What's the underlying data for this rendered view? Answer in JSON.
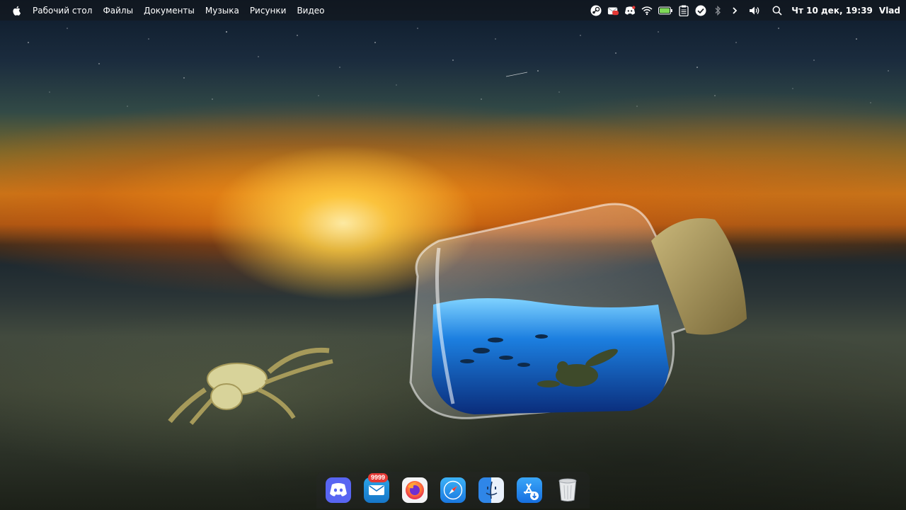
{
  "menubar": {
    "apple_icon": "apple-logo-icon",
    "items": [
      {
        "label": "Рабочий стол"
      },
      {
        "label": "Файлы"
      },
      {
        "label": "Документы"
      },
      {
        "label": "Музыка"
      },
      {
        "label": "Рисунки"
      },
      {
        "label": "Видео"
      }
    ],
    "tray": {
      "icons": [
        "steam-icon",
        "mail-icon",
        "discord-icon",
        "wifi-icon",
        "battery-icon",
        "clipboard-icon",
        "check-icon",
        "bluetooth-icon",
        "chevron-right-icon",
        "volume-icon",
        "search-icon"
      ],
      "clock": "Чт 10 дек, 19:39",
      "username": "Vlad"
    }
  },
  "dock": {
    "items": [
      {
        "name": "Discord",
        "icon": "discord-icon"
      },
      {
        "name": "Mail",
        "icon": "mail-icon",
        "badge": "9999"
      },
      {
        "name": "Firefox",
        "icon": "firefox-icon"
      },
      {
        "name": "Safari",
        "icon": "safari-icon"
      },
      {
        "name": "Finder",
        "icon": "finder-icon"
      },
      {
        "name": "App Store",
        "icon": "app-store-icon"
      },
      {
        "name": "Trash",
        "icon": "trash-icon"
      }
    ]
  },
  "colors": {
    "menubar_bg": "#16181c",
    "badge": "#e53935",
    "discord": "#5865f2",
    "sky_sunset": "#c7781a"
  }
}
